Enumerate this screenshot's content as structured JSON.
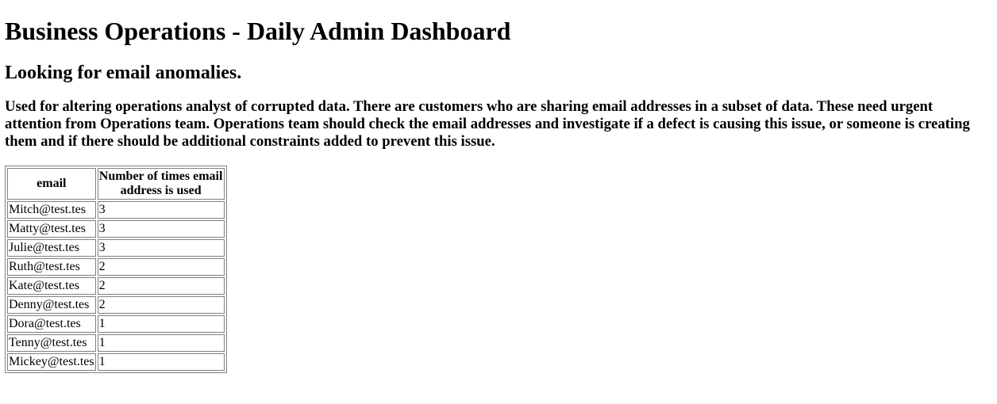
{
  "page": {
    "title": "Business Operations - Daily Admin Dashboard",
    "subtitle": "Looking for email anomalies.",
    "description": "Used for altering operations analyst of corrupted data. There are customers who are sharing email addresses in a subset of data. These need urgent attention from Operations team. Operations team should check the email addresses and investigate if a defect is causing this issue, or someone is creating them and if there should be additional constraints added to prevent this issue."
  },
  "table": {
    "columns": [
      "email",
      "Number of times email address is used"
    ],
    "rows": [
      {
        "email": "Mitch@test.tes",
        "count": "3"
      },
      {
        "email": "Matty@test.tes",
        "count": "3"
      },
      {
        "email": "Julie@test.tes",
        "count": "3"
      },
      {
        "email": "Ruth@test.tes",
        "count": "2"
      },
      {
        "email": "Kate@test.tes",
        "count": "2"
      },
      {
        "email": "Denny@test.tes",
        "count": "2"
      },
      {
        "email": "Dora@test.tes",
        "count": "1"
      },
      {
        "email": "Tenny@test.tes",
        "count": "1"
      },
      {
        "email": "Mickey@test.tes",
        "count": "1"
      }
    ]
  }
}
